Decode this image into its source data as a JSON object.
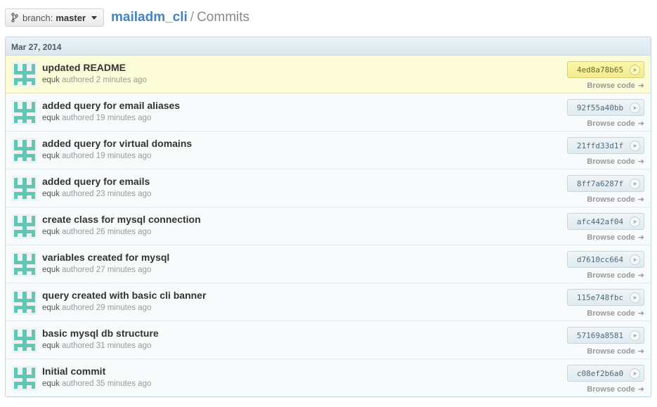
{
  "header": {
    "branch_prefix": "branch:",
    "branch_name": "master",
    "repo_name": "mailadm_cli",
    "separator": "/",
    "section": "Commits"
  },
  "group": {
    "date": "Mar 27, 2014"
  },
  "browse_label": "Browse code",
  "commits": [
    {
      "message": "updated README",
      "author": "equk",
      "authored": "authored 2 minutes ago",
      "sha": "4ed8a78b65",
      "highlight": true
    },
    {
      "message": "added query for email aliases",
      "author": "equk",
      "authored": "authored 19 minutes ago",
      "sha": "92f55a40bb",
      "highlight": false
    },
    {
      "message": "added query for virtual domains",
      "author": "equk",
      "authored": "authored 19 minutes ago",
      "sha": "21ffd33d1f",
      "highlight": false
    },
    {
      "message": "added query for emails",
      "author": "equk",
      "authored": "authored 23 minutes ago",
      "sha": "8ff7a6287f",
      "highlight": false
    },
    {
      "message": "create class for mysql connection",
      "author": "equk",
      "authored": "authored 26 minutes ago",
      "sha": "afc442af04",
      "highlight": false
    },
    {
      "message": "variables created for mysql",
      "author": "equk",
      "authored": "authored 27 minutes ago",
      "sha": "d7610cc664",
      "highlight": false
    },
    {
      "message": "query created with basic cli banner",
      "author": "equk",
      "authored": "authored 29 minutes ago",
      "sha": "115e748fbc",
      "highlight": false
    },
    {
      "message": "basic mysql db structure",
      "author": "equk",
      "authored": "authored 31 minutes ago",
      "sha": "57169a8581",
      "highlight": false
    },
    {
      "message": "Initial commit",
      "author": "equk",
      "authored": "authored 35 minutes ago",
      "sha": "c08ef2b6a0",
      "highlight": false
    }
  ],
  "colors": {
    "link": "#4183c4",
    "avatar": "#5fc8b4",
    "highlight_row": "#fcfdd8"
  },
  "icons": {
    "branch": "branch-icon",
    "caret": "chevron-down-icon",
    "sha_arrow": "arrow-right-circle-icon",
    "browse_arrow": "arrow-right-icon"
  }
}
